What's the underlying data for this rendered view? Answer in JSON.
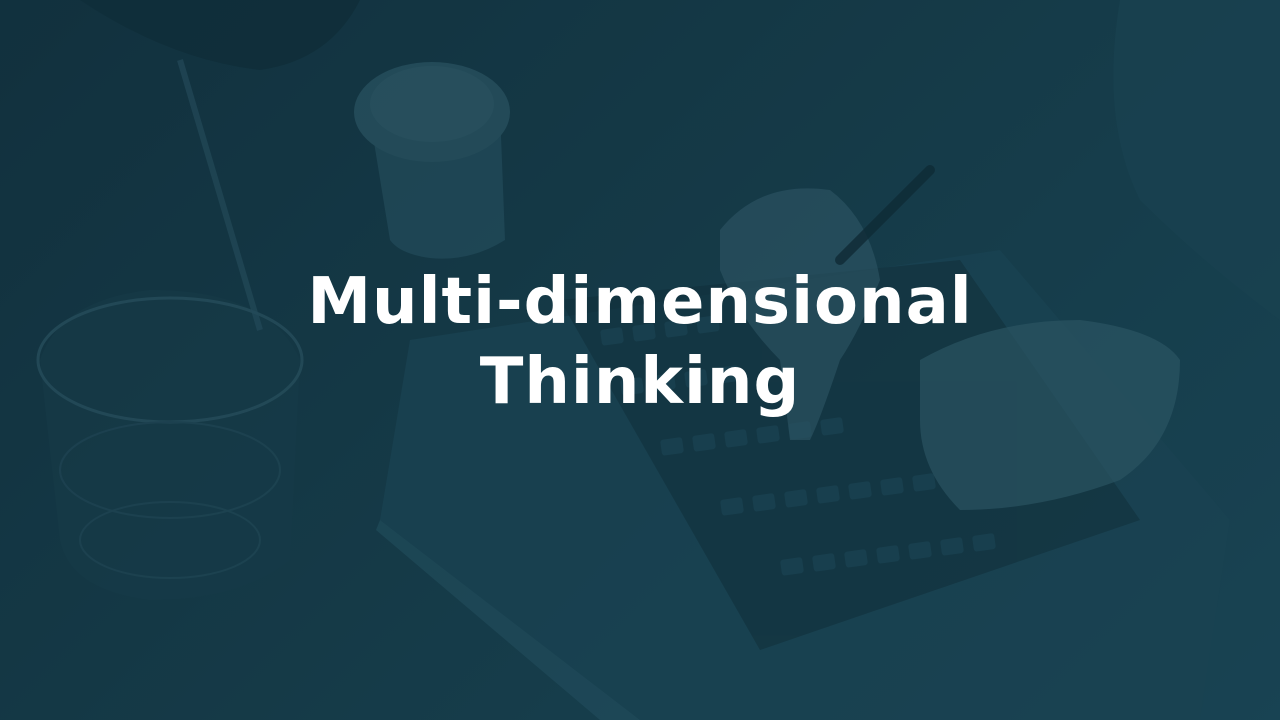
{
  "slide": {
    "title_line_1": "Multi-dimensional",
    "title_line_2": "Thinking"
  },
  "colors": {
    "overlay": "#173d4a",
    "text": "#ffffff"
  },
  "background_photo": {
    "subjects": [
      "coffee-cup",
      "glass",
      "tablet-keyboard",
      "hands",
      "pen"
    ]
  }
}
